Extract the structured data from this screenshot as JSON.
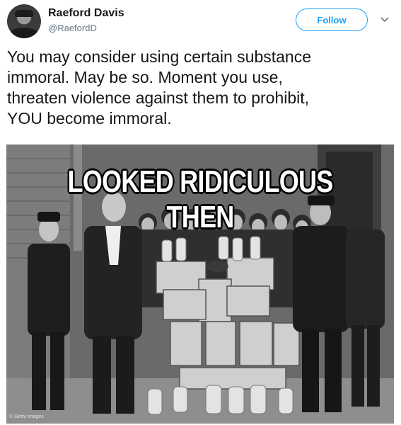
{
  "author": {
    "display_name": "Raeford Davis",
    "handle": "@RaefordD"
  },
  "actions": {
    "follow_label": "Follow"
  },
  "tweet": {
    "lines": [
      "You may consider using certain substance",
      "immoral. May be so. Moment you use,",
      "threaten violence against them to prohibit,",
      "YOU become immoral."
    ]
  },
  "media": {
    "caption": "LOOKED RIDICULOUS THEN",
    "credit": "© Getty Images"
  },
  "colors": {
    "accent": "#1da1f2",
    "text": "#14171a",
    "muted": "#657786"
  },
  "icons": {
    "menu": "chevron-down-icon"
  }
}
